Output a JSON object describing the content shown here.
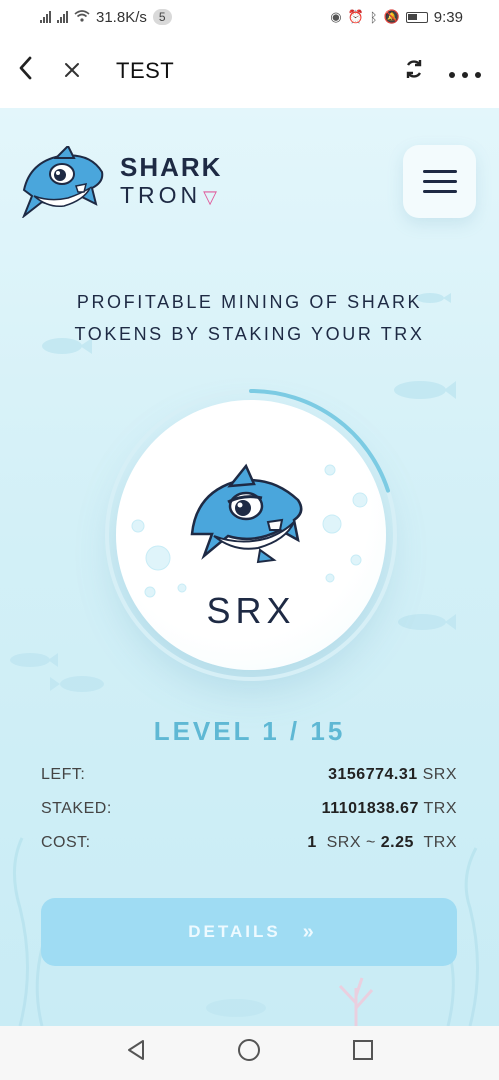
{
  "status_bar": {
    "speed": "31.8K/s",
    "badge": "5",
    "time": "9:39"
  },
  "app_bar": {
    "title": "TEST"
  },
  "logo": {
    "line1": "SHARK",
    "line2": "TRON"
  },
  "headline": {
    "line1": "PROFITABLE MINING OF SHARK",
    "line2": "TOKENS BY STAKING YOUR TRX"
  },
  "coin": {
    "name": "SRX",
    "progress": 0.2
  },
  "level": {
    "text": "LEVEL 1 / 15"
  },
  "stats": {
    "left": {
      "label": "LEFT:",
      "amount": "3156774.31",
      "unit": "SRX"
    },
    "staked": {
      "label": "STAKED:",
      "amount": "11101838.67",
      "unit": "TRX"
    },
    "cost": {
      "label": "COST:",
      "qty": "1",
      "unit1": "SRX ~",
      "price": "2.25",
      "unit2": "TRX"
    }
  },
  "details_button": {
    "label": "DETAILS",
    "chevron": "»"
  },
  "colors": {
    "accent": "#5fb8d4",
    "button": "#9fdcf3",
    "text_dark": "#1e2a44",
    "tron": "#e05a9b"
  }
}
